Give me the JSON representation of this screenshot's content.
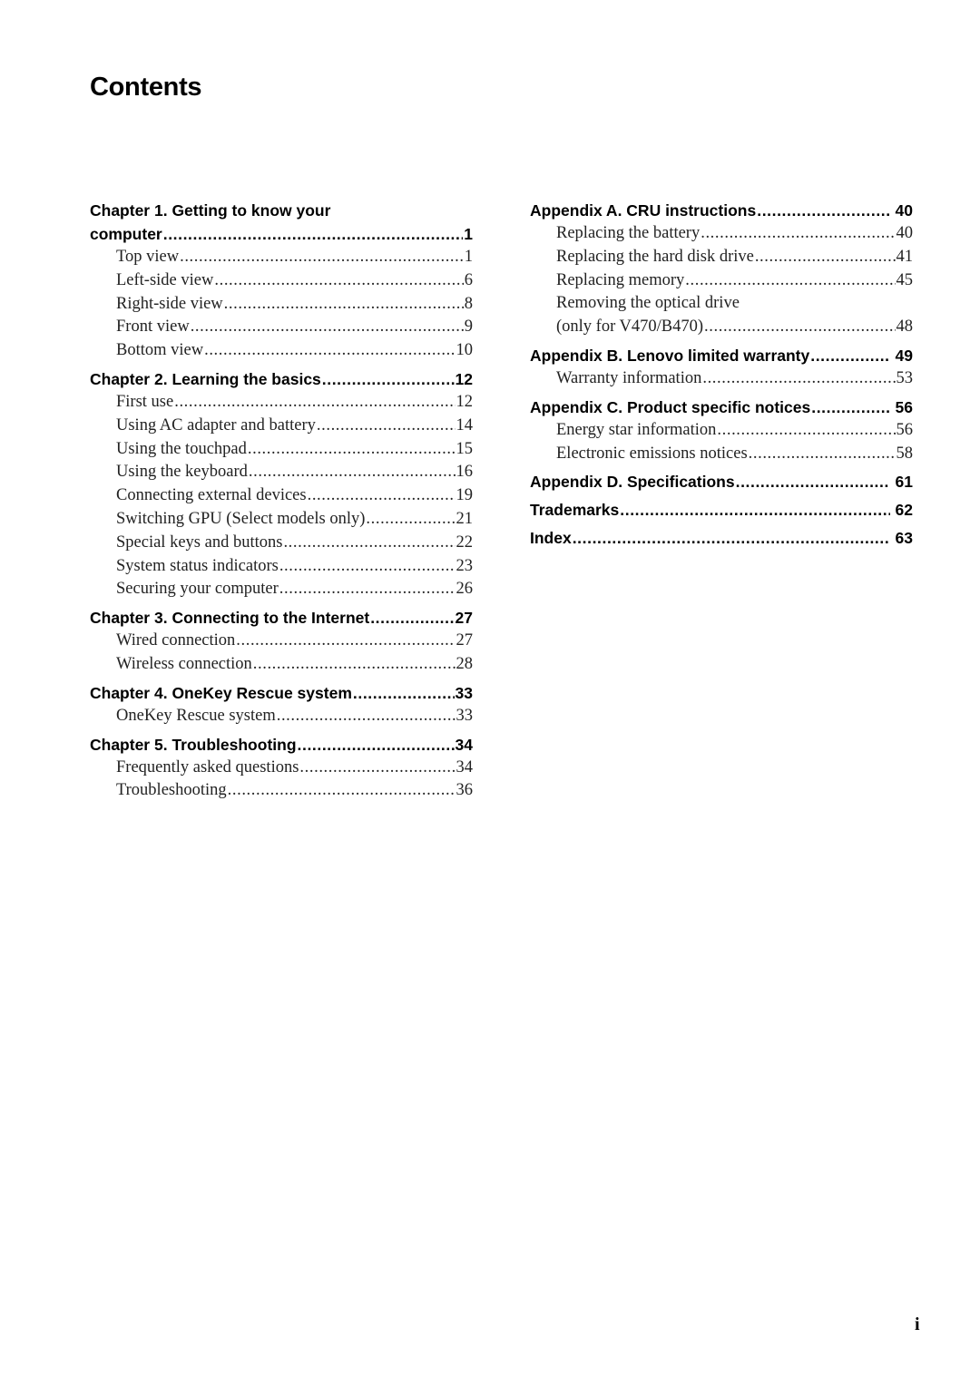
{
  "title": "Contents",
  "left_column": {
    "chapters": [
      {
        "title_line1": "Chapter 1. Getting to know your",
        "title": "computer",
        "page": "1",
        "entries": [
          {
            "label": "Top view",
            "page": "1"
          },
          {
            "label": "Left-side view",
            "page": "6"
          },
          {
            "label": "Right-side view",
            "page": "8"
          },
          {
            "label": "Front view",
            "page": "9"
          },
          {
            "label": "Bottom view",
            "page": "10"
          }
        ]
      },
      {
        "title": "Chapter 2. Learning the basics",
        "page": "12",
        "entries": [
          {
            "label": "First use",
            "page": "12"
          },
          {
            "label": "Using AC adapter and battery",
            "page": "14"
          },
          {
            "label": "Using the touchpad",
            "page": "15"
          },
          {
            "label": "Using the keyboard",
            "page": "16"
          },
          {
            "label": "Connecting external devices",
            "page": "19"
          },
          {
            "label": "Switching GPU (Select models only)",
            "page": "21"
          },
          {
            "label": "Special keys and buttons",
            "page": "22"
          },
          {
            "label": "System status indicators",
            "page": "23"
          },
          {
            "label": "Securing your computer",
            "page": "26"
          }
        ]
      },
      {
        "title": "Chapter 3. Connecting to the Internet",
        "page": "27",
        "entries": [
          {
            "label": "Wired connection",
            "page": "27"
          },
          {
            "label": "Wireless connection",
            "page": "28"
          }
        ]
      },
      {
        "title": "Chapter 4. OneKey Rescue system",
        "page": "33",
        "entries": [
          {
            "label": "OneKey Rescue system",
            "page": "33"
          }
        ]
      },
      {
        "title": "Chapter 5. Troubleshooting",
        "page": "34",
        "entries": [
          {
            "label": "Frequently asked questions",
            "page": "34"
          },
          {
            "label": "Troubleshooting",
            "page": "36"
          }
        ]
      }
    ]
  },
  "right_column": {
    "sections": [
      {
        "title": "Appendix A. CRU instructions",
        "page": "40",
        "entries": [
          {
            "label": "Replacing the battery",
            "page": "40"
          },
          {
            "label": "Replacing the hard disk drive",
            "page": "41"
          },
          {
            "label": "Replacing memory",
            "page": "45"
          },
          {
            "label_line1": "Removing the optical drive",
            "label": "(only for V470/B470)",
            "page": "48"
          }
        ]
      },
      {
        "title": "Appendix B. Lenovo limited warranty",
        "page": "49",
        "entries": [
          {
            "label": "Warranty information",
            "page": "53"
          }
        ]
      },
      {
        "title": "Appendix C. Product specific notices",
        "page": "56",
        "entries": [
          {
            "label": "Energy star information",
            "page": "56"
          },
          {
            "label": "Electronic emissions notices",
            "page": "58"
          }
        ]
      },
      {
        "title": "Appendix D. Specifications",
        "page": "61",
        "entries": []
      },
      {
        "title": "Trademarks",
        "page": "62",
        "entries": []
      },
      {
        "title": "Index",
        "page": "63",
        "entries": []
      }
    ]
  },
  "footer": {
    "page_number": "i"
  }
}
